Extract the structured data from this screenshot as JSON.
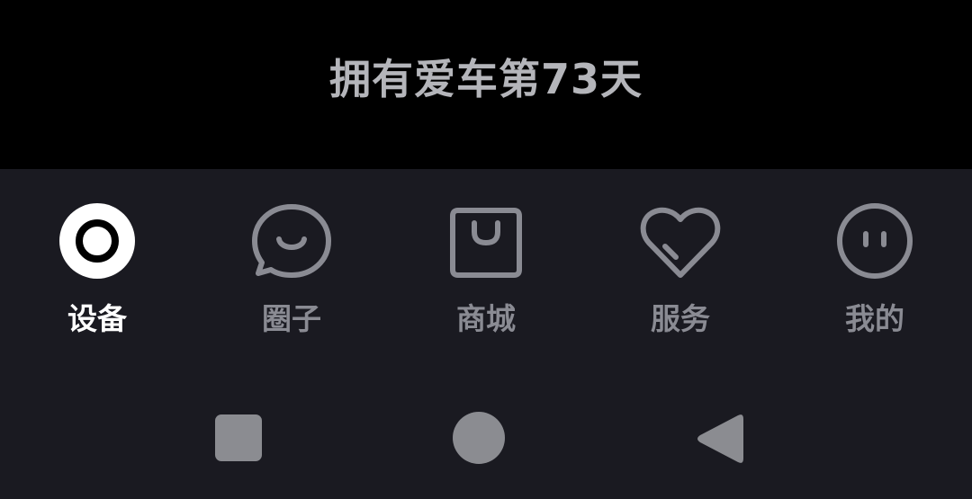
{
  "header": {
    "ownership_text": "拥有爱车第73天"
  },
  "tabs": [
    {
      "label": "设备",
      "icon": "device-ring-icon",
      "active": true
    },
    {
      "label": "圈子",
      "icon": "chat-bubble-smile-icon",
      "active": false
    },
    {
      "label": "商城",
      "icon": "shopping-bag-icon",
      "active": false
    },
    {
      "label": "服务",
      "icon": "heart-icon",
      "active": false
    },
    {
      "label": "我的",
      "icon": "face-icon",
      "active": false
    }
  ],
  "system_nav": {
    "buttons": [
      "recent-apps-icon",
      "home-icon",
      "back-icon"
    ]
  },
  "colors": {
    "top_background": "#000000",
    "nav_background": "#1a1a21",
    "active": "#ffffff",
    "inactive": "#8a8b93",
    "system_buttons": "#8b8c91"
  }
}
